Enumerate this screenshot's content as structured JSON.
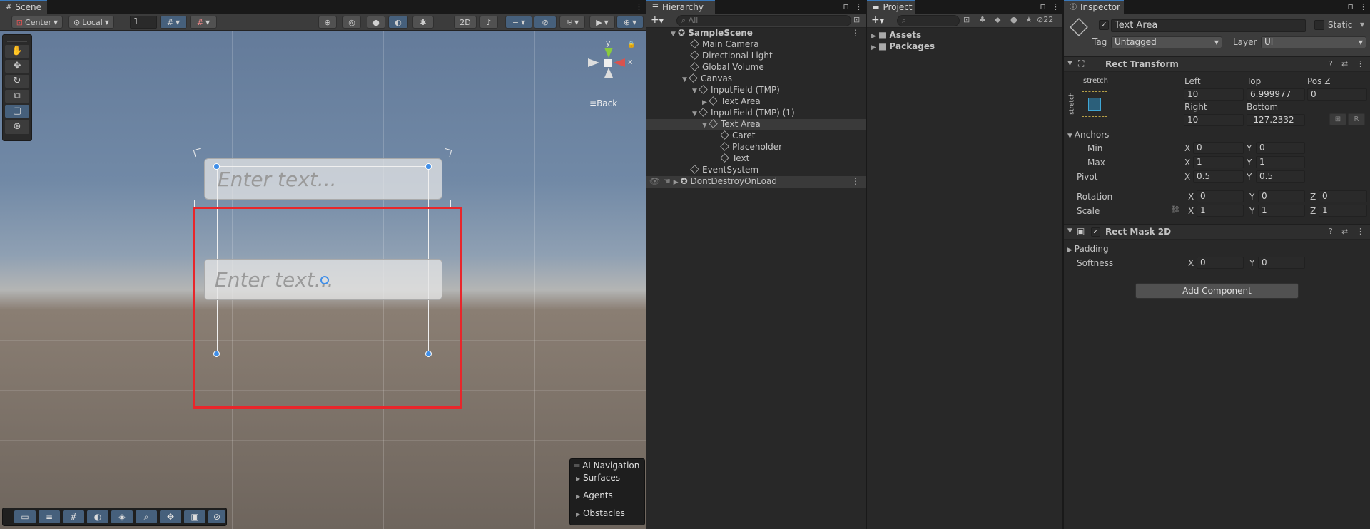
{
  "scene": {
    "tab_label": "Scene",
    "pivot_label": "Center",
    "space_label": "Local",
    "grid_value": "1",
    "mode_2d": "2D",
    "back_label": "Back",
    "gizmo_y": "y",
    "gizmo_x": "x",
    "input_placeholder_1": "Enter text...",
    "input_placeholder_2": "Enter text...",
    "selection_color": "#e8262b",
    "ai_nav": {
      "title": "AI Navigation",
      "items": [
        "Surfaces",
        "Agents",
        "Obstacles"
      ]
    }
  },
  "hierarchy": {
    "tab_label": "Hierarchy",
    "search_placeholder": "All",
    "rows": [
      {
        "label": "SampleScene",
        "icon": "unity-scene-icon"
      },
      {
        "label": "Main Camera",
        "icon": "cube-icon"
      },
      {
        "label": "Directional Light",
        "icon": "cube-icon"
      },
      {
        "label": "Global Volume",
        "icon": "cube-icon"
      },
      {
        "label": "Canvas",
        "icon": "cube-icon"
      },
      {
        "label": "InputField (TMP)",
        "icon": "cube-icon"
      },
      {
        "label": "Text Area",
        "icon": "cube-icon"
      },
      {
        "label": "InputField (TMP) (1)",
        "icon": "cube-icon"
      },
      {
        "label": "Text Area",
        "icon": "cube-icon"
      },
      {
        "label": "Caret",
        "icon": "cube-icon"
      },
      {
        "label": "Placeholder",
        "icon": "cube-icon"
      },
      {
        "label": "Text",
        "icon": "cube-icon"
      },
      {
        "label": "EventSystem",
        "icon": "cube-icon"
      },
      {
        "label": "DontDestroyOnLoad",
        "icon": "unity-scene-icon"
      }
    ]
  },
  "project": {
    "tab_label": "Project",
    "hidden_count": "22",
    "folders": [
      "Assets",
      "Packages"
    ]
  },
  "inspector": {
    "tab_label": "Inspector",
    "object_name": "Text Area",
    "static_label": "Static",
    "tag_label": "Tag",
    "tag_value": "Untagged",
    "layer_label": "Layer",
    "layer_value": "UI",
    "rect_transform": {
      "title": "Rect Transform",
      "stretch_label": "stretch",
      "left_label": "Left",
      "left_value": "10",
      "top_label": "Top",
      "top_value": "6.999977",
      "posz_label": "Pos Z",
      "posz_value": "0",
      "right_label": "Right",
      "right_value": "10",
      "bottom_label": "Bottom",
      "bottom_value": "-127.2332",
      "r_button": "R",
      "anchors_label": "Anchors",
      "min_label": "Min",
      "min_x": "0",
      "min_y": "0",
      "max_label": "Max",
      "max_x": "1",
      "max_y": "1",
      "pivot_label": "Pivot",
      "pivot_x": "0.5",
      "pivot_y": "0.5",
      "rotation_label": "Rotation",
      "rot_x": "0",
      "rot_y": "0",
      "rot_z": "0",
      "scale_label": "Scale",
      "scale_x": "1",
      "scale_y": "1",
      "scale_z": "1"
    },
    "rect_mask": {
      "title": "Rect Mask 2D",
      "padding_label": "Padding",
      "softness_label": "Softness",
      "softness_x": "0",
      "softness_y": "0"
    },
    "add_component": "Add Component",
    "axis": {
      "x": "X",
      "y": "Y",
      "z": "Z"
    }
  }
}
